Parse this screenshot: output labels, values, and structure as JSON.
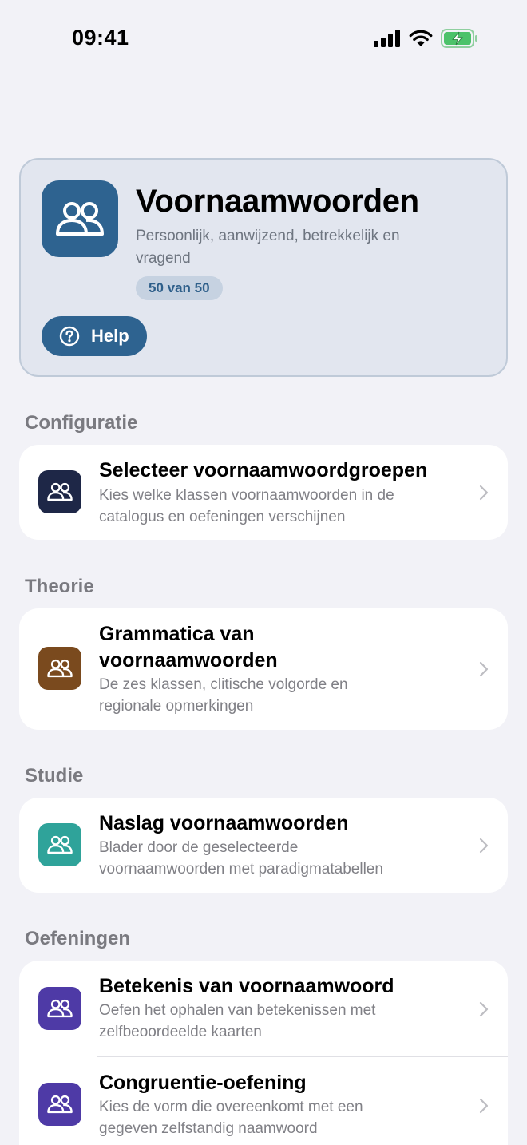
{
  "status_bar": {
    "time": "09:41"
  },
  "hero": {
    "icon": "people-icon",
    "title": "Voornaamwoorden",
    "subtitle": "Persoonlijk, aanwijzend, betrekkelijk en vragend",
    "badge": "50 van 50",
    "help_label": "Help",
    "accent": "#2E6390"
  },
  "sections": {
    "configuratie": {
      "header": "Configuratie",
      "items": [
        {
          "title": "Selecteer voornaamwoordgroepen",
          "subtitle": "Kies welke klassen voornaamwoorden in de catalogus en oefeningen verschijnen",
          "icon": "people-icon",
          "color": "#1E2747"
        }
      ]
    },
    "theorie": {
      "header": "Theorie",
      "items": [
        {
          "title": "Grammatica van voornaamwoorden",
          "subtitle": "De zes klassen, clitische volgorde en regionale opmerkingen",
          "icon": "people-icon",
          "color": "#7A4A1E"
        }
      ]
    },
    "studie": {
      "header": "Studie",
      "items": [
        {
          "title": "Naslag voornaamwoorden",
          "subtitle": "Blader door de geselecteerde voornaamwoorden met paradigmatabellen",
          "icon": "people-icon",
          "color": "#2FA39A"
        }
      ]
    },
    "oefeningen": {
      "header": "Oefeningen",
      "items": [
        {
          "title": "Betekenis van voornaamwoord",
          "subtitle": "Oefen het ophalen van betekenissen met zelfbeoordeelde kaarten",
          "icon": "people-icon",
          "color": "#4E3AA6"
        },
        {
          "title": "Congruentie-oefening",
          "subtitle": "Kies de vorm die overeenkomt met een gegeven zelfstandig naamwoord",
          "icon": "people-icon",
          "color": "#4E3AA6"
        }
      ]
    }
  }
}
